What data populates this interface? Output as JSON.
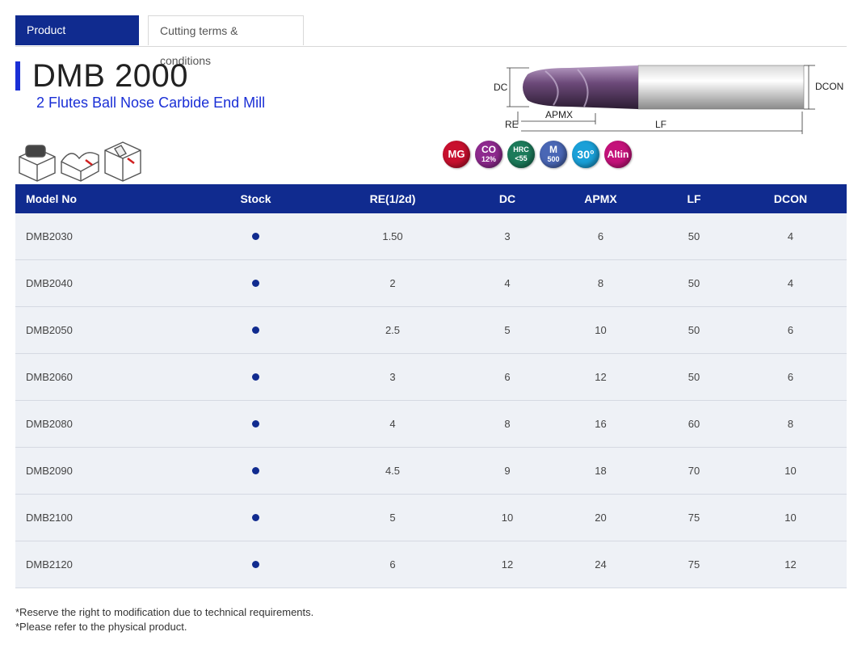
{
  "tabs": [
    {
      "label": "Product Introduction",
      "active": true
    },
    {
      "label": "Cutting terms & conditions",
      "active": false
    }
  ],
  "product": {
    "title": "DMB 2000",
    "subtitle": "2 Flutes Ball Nose Carbide End Mill"
  },
  "diagram_labels": {
    "dc": "DC",
    "re": "RE",
    "apmx": "APMX",
    "lf": "LF",
    "dcon": "DCON"
  },
  "badges": [
    {
      "icon": "mg-badge-icon",
      "line1": "MG",
      "line2": "",
      "color": "#c8102e"
    },
    {
      "icon": "co-badge-icon",
      "line1": "CO",
      "line2": "12%",
      "color": "#8e2a8e"
    },
    {
      "icon": "hrc-badge-icon",
      "line1": "HRC",
      "line2": "<55",
      "color": "#1c7a5a"
    },
    {
      "icon": "m-badge-icon",
      "line1": "M",
      "line2": "500",
      "color": "#4a67b5"
    },
    {
      "icon": "helix-30-badge-icon",
      "line1": "30°",
      "line2": "",
      "color": "#1aa0d8"
    },
    {
      "icon": "altin-badge-icon",
      "line1": "Altin",
      "line2": "",
      "color": "#c4127a"
    }
  ],
  "table": {
    "headers": [
      "Model No",
      "Stock",
      "RE(1/2d)",
      "DC",
      "APMX",
      "LF",
      "DCON"
    ],
    "rows": [
      [
        "DMB2030",
        "●",
        "1.50",
        "3",
        "6",
        "50",
        "4"
      ],
      [
        "DMB2040",
        "●",
        "2",
        "4",
        "8",
        "50",
        "4"
      ],
      [
        "DMB2050",
        "●",
        "2.5",
        "5",
        "10",
        "50",
        "6"
      ],
      [
        "DMB2060",
        "●",
        "3",
        "6",
        "12",
        "50",
        "6"
      ],
      [
        "DMB2080",
        "●",
        "4",
        "8",
        "16",
        "60",
        "8"
      ],
      [
        "DMB2090",
        "●",
        "4.5",
        "9",
        "18",
        "70",
        "10"
      ],
      [
        "DMB2100",
        "●",
        "5",
        "10",
        "20",
        "75",
        "10"
      ],
      [
        "DMB2120",
        "●",
        "6",
        "12",
        "24",
        "75",
        "12"
      ]
    ]
  },
  "notes": [
    "*Reserve the right to modification due to technical requirements.",
    "*Please refer to the physical product."
  ]
}
